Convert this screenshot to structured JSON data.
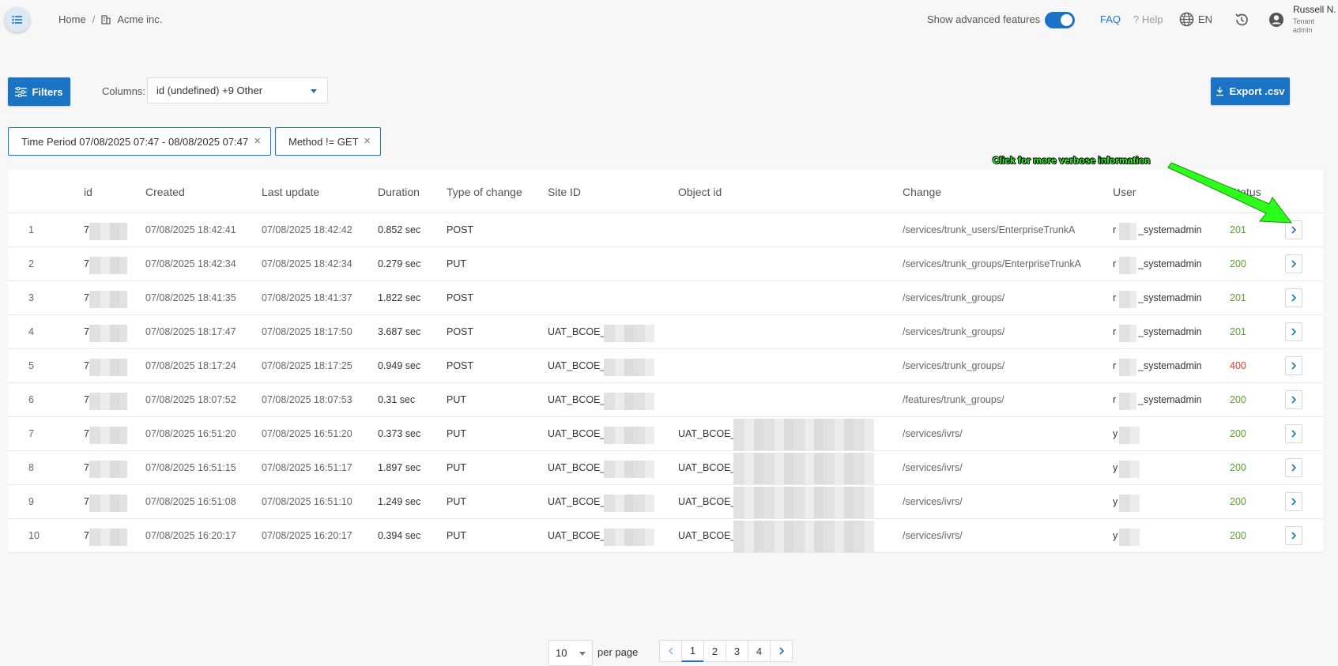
{
  "header": {
    "breadcrumb": {
      "home": "Home",
      "tenant": "Acme inc."
    },
    "advanced_label": "Show advanced features",
    "faq": "FAQ",
    "help": "? Help",
    "language": "EN",
    "user": {
      "name": "Russell N.",
      "role": "Tenant admin"
    }
  },
  "toolbar": {
    "filters_label": "Filters",
    "columns_label": "Columns:",
    "columns_value": "id (undefined) +9 Other",
    "export_label": "Export .csv"
  },
  "chips": [
    {
      "label": "Time Period 07/08/2025 07:47 - 08/08/2025 07:47"
    },
    {
      "label": "Method != GET"
    }
  ],
  "table": {
    "columns": [
      "id",
      "Created",
      "Last update",
      "Duration",
      "Type of change",
      "Site ID",
      "Object id",
      "Change",
      "User",
      "Status"
    ],
    "rows": [
      {
        "n": "1",
        "id": "7",
        "created": "07/08/2025 18:42:41",
        "updated": "07/08/2025 18:42:42",
        "duration": "0.852 sec",
        "type": "POST",
        "site": "",
        "object": "",
        "change": "/services/trunk_users/EnterpriseTrunkA",
        "user_a": "r",
        "user_b": "_systemadmin",
        "status": "201"
      },
      {
        "n": "2",
        "id": "7",
        "created": "07/08/2025 18:42:34",
        "updated": "07/08/2025 18:42:34",
        "duration": "0.279 sec",
        "type": "PUT",
        "site": "",
        "object": "",
        "change": "/services/trunk_groups/EnterpriseTrunkA",
        "user_a": "r",
        "user_b": "_systemadmin",
        "status": "200"
      },
      {
        "n": "3",
        "id": "7",
        "created": "07/08/2025 18:41:35",
        "updated": "07/08/2025 18:41:37",
        "duration": "1.822 sec",
        "type": "POST",
        "site": "",
        "object": "",
        "change": "/services/trunk_groups/",
        "user_a": "r",
        "user_b": "_systemadmin",
        "status": "201"
      },
      {
        "n": "4",
        "id": "7",
        "created": "07/08/2025 18:17:47",
        "updated": "07/08/2025 18:17:50",
        "duration": "3.687 sec",
        "type": "POST",
        "site": "UAT_BCOE_e",
        "object": "",
        "change": "/services/trunk_groups/",
        "user_a": "r",
        "user_b": "_systemadmin",
        "status": "201"
      },
      {
        "n": "5",
        "id": "7",
        "created": "07/08/2025 18:17:24",
        "updated": "07/08/2025 18:17:25",
        "duration": "0.949 sec",
        "type": "POST",
        "site": "UAT_BCOE_e",
        "object": "",
        "change": "/services/trunk_groups/",
        "user_a": "r",
        "user_b": "_systemadmin",
        "status": "400"
      },
      {
        "n": "6",
        "id": "7",
        "created": "07/08/2025 18:07:52",
        "updated": "07/08/2025 18:07:53",
        "duration": "0.31 sec",
        "type": "PUT",
        "site": "UAT_BCOE_e",
        "object": "",
        "change": "/features/trunk_groups/",
        "user_a": "r",
        "user_b": "_systemadmin",
        "status": "200"
      },
      {
        "n": "7",
        "id": "7",
        "created": "07/08/2025 16:51:20",
        "updated": "07/08/2025 16:51:20",
        "duration": "0.373 sec",
        "type": "PUT",
        "site": "UAT_BCOE_e",
        "object": "UAT_BCOE_",
        "change": "/services/ivrs/",
        "user_a": "y",
        "user_b": "",
        "status": "200"
      },
      {
        "n": "8",
        "id": "7",
        "created": "07/08/2025 16:51:15",
        "updated": "07/08/2025 16:51:17",
        "duration": "1.897 sec",
        "type": "PUT",
        "site": "UAT_BCOE_e",
        "object": "UAT_BCOE_",
        "change": "/services/ivrs/",
        "user_a": "y",
        "user_b": "",
        "status": "200"
      },
      {
        "n": "9",
        "id": "7",
        "created": "07/08/2025 16:51:08",
        "updated": "07/08/2025 16:51:10",
        "duration": "1.249 sec",
        "type": "PUT",
        "site": "UAT_BCOE_e",
        "object": "UAT_BCOE_",
        "change": "/services/ivrs/",
        "user_a": "y",
        "user_b": "",
        "status": "200"
      },
      {
        "n": "10",
        "id": "7",
        "created": "07/08/2025 16:20:17",
        "updated": "07/08/2025 16:20:17",
        "duration": "0.394 sec",
        "type": "PUT",
        "site": "UAT_BCOE_e",
        "object": "UAT_BCOE_",
        "change": "/services/ivrs/",
        "user_a": "y",
        "user_b": "",
        "status": "200"
      }
    ]
  },
  "annotation": "Click for more verbose information",
  "pagination": {
    "per_page_value": "10",
    "per_page_label": "per page",
    "pages": [
      "1",
      "2",
      "3",
      "4"
    ],
    "current": "1"
  },
  "colors": {
    "accent": "#1a73c4",
    "status_ok": "#5aa02c",
    "status_error": "#e03a2c",
    "annotation": "#2cff1a"
  },
  "icons": [
    "menu-icon",
    "building-icon",
    "globe-icon",
    "history-icon",
    "account-circle-icon",
    "filter-sliders-icon",
    "download-icon",
    "close-icon",
    "chevron-right-icon",
    "chevron-left-icon",
    "caret-down-icon"
  ]
}
